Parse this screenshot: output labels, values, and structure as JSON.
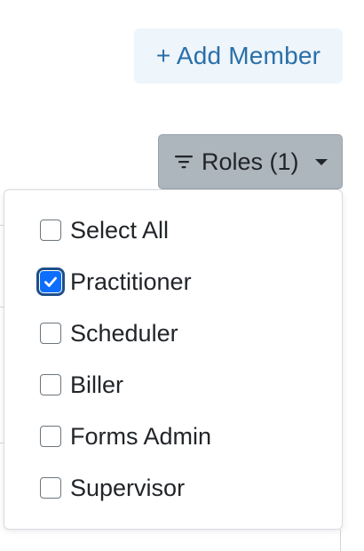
{
  "header": {
    "add_member_label": "+ Add Member"
  },
  "filter": {
    "roles_button_label": "Roles (1)",
    "options": [
      {
        "label": "Select All",
        "checked": false
      },
      {
        "label": "Practitioner",
        "checked": true
      },
      {
        "label": "Scheduler",
        "checked": false
      },
      {
        "label": "Biller",
        "checked": false
      },
      {
        "label": "Forms Admin",
        "checked": false
      },
      {
        "label": "Supervisor",
        "checked": false
      }
    ]
  },
  "colors": {
    "accent": "#0d6efd",
    "add_button_text": "#2a6fa8",
    "add_button_bg": "#eef5fb",
    "roles_button_bg": "#adb5bd"
  },
  "icons": {
    "roles_button": "filter-icon",
    "roles_caret": "chevron-down-icon",
    "checkbox_check": "check-icon"
  }
}
